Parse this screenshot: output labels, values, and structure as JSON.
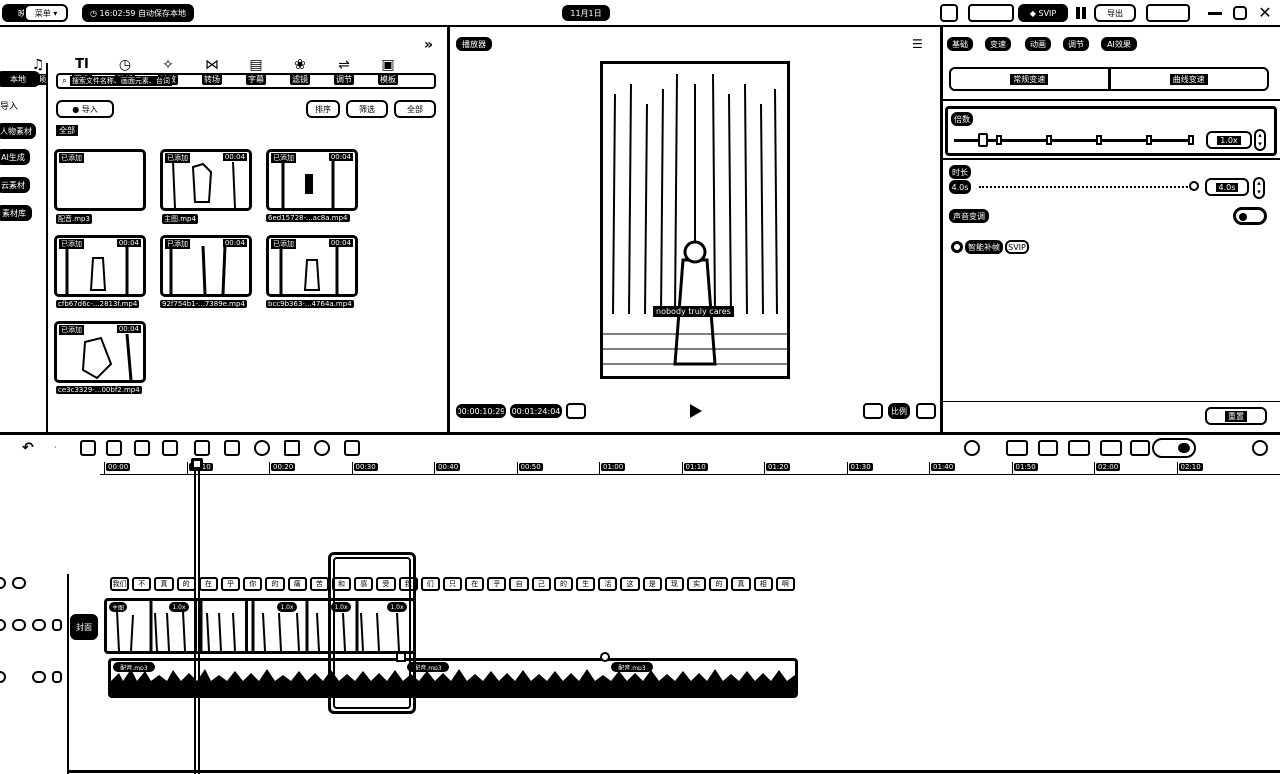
{
  "topbar": {
    "app_label": "映",
    "menu_label": "菜单",
    "autosave": "16:02:59 自动保存本地",
    "project_title": "11月1日",
    "vip_label": "SVIP",
    "export_label": "导出"
  },
  "toolbar": {
    "items": [
      {
        "label": "音频",
        "icon": "music-icon"
      },
      {
        "label": "文本",
        "icon": "text-icon"
      },
      {
        "label": "贴纸",
        "icon": "sticker-icon"
      },
      {
        "label": "特效",
        "icon": "effects-icon"
      },
      {
        "label": "转场",
        "icon": "transition-icon"
      },
      {
        "label": "字幕",
        "icon": "caption-icon"
      },
      {
        "label": "滤镜",
        "icon": "filter-icon"
      },
      {
        "label": "调节",
        "icon": "adjust-icon"
      },
      {
        "label": "模板",
        "icon": "template-icon"
      }
    ]
  },
  "left_sidebar": {
    "items": [
      "本地",
      "导入",
      "人物素材",
      "AI生成",
      "云素材",
      "素材库"
    ]
  },
  "media": {
    "search_placeholder": "搜索文件名称、画面元素、台词",
    "import_label": "导入",
    "sort_label": "排序",
    "filter_label": "筛选",
    "all_label": "全部",
    "section_label": "全部",
    "items": [
      {
        "tag": "已添加",
        "duration": "",
        "name": "配音.mp3"
      },
      {
        "tag": "已添加",
        "duration": "00:04",
        "name": "主图.mp4"
      },
      {
        "tag": "已添加",
        "duration": "00:04",
        "name": "6ed15728-...ac8a.mp4"
      },
      {
        "tag": "已添加",
        "duration": "00:04",
        "name": "cfb67d6c-...2813f.mp4"
      },
      {
        "tag": "已添加",
        "duration": "00:04",
        "name": "92f754b1-...7389e.mp4"
      },
      {
        "tag": "已添加",
        "duration": "00:04",
        "name": "bcc9b363-...4764a.mp4"
      },
      {
        "tag": "已添加",
        "duration": "00:04",
        "name": "ce3c3329-...00bf2.mp4"
      }
    ]
  },
  "player": {
    "title": "播放器",
    "subtitle": "nobody truly cares",
    "current_time": "00:00:10:29",
    "total_time": "00:01:24:04",
    "quality_label": "比例",
    "fullscreen_label": "全屏"
  },
  "props": {
    "tabs": [
      "基础",
      "变速",
      "动画",
      "调节",
      "AI效果"
    ],
    "speed_tabs": [
      "常规变速",
      "曲线变速"
    ],
    "speed_label": "倍数",
    "speed_value": "1.0x",
    "speed_fraction": 0.1,
    "duration_label": "时长",
    "duration_start": "4.0s",
    "duration_value": "4.0s",
    "pitch_label": "声音变调",
    "smooth_label": "智能补帧",
    "smooth_badge": "SVIP",
    "reset_label": "重置"
  },
  "timeline": {
    "ruler": [
      "00:00",
      "00:10",
      "00:20",
      "00:30",
      "00:40",
      "00:50",
      "01:00",
      "01:10",
      "01:20",
      "01:30",
      "01:40",
      "01:50",
      "02:00",
      "02:10"
    ],
    "cover_label": "封面",
    "audio_clips": [
      "配音.mp3",
      "配音.mp3",
      "配音.mp3"
    ],
    "video_clips": [
      "主图",
      "1.0x",
      "1.0x",
      "1.0x",
      "1.0x"
    ],
    "subtitle_clips": [
      "我们",
      "不",
      "真",
      "的",
      "在",
      "乎",
      "你",
      "的",
      "痛",
      "苦",
      "和",
      "感",
      "受",
      "我",
      "们",
      "只",
      "在",
      "乎",
      "自",
      "己",
      "的",
      "生",
      "活",
      "这",
      "是",
      "现",
      "实",
      "的",
      "真",
      "相",
      "啊"
    ]
  }
}
